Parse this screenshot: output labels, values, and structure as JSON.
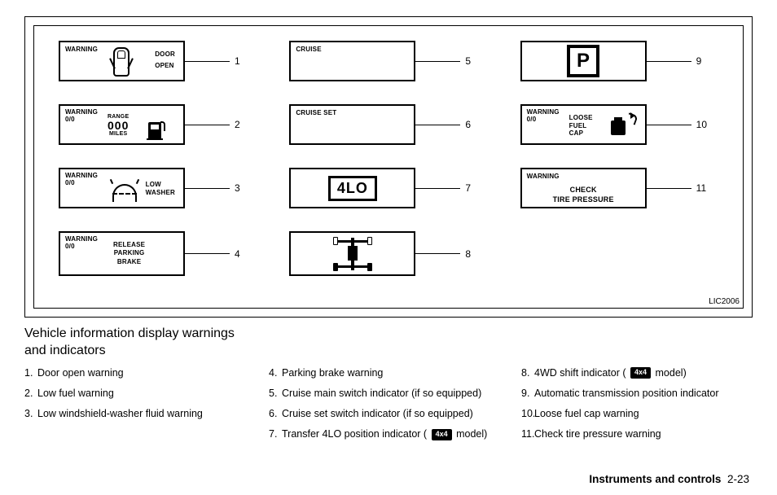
{
  "figure_code": "LIC2006",
  "panels": {
    "p1": {
      "label": "WARNING",
      "right1": "DOOR",
      "right2": "OPEN",
      "num": "1"
    },
    "p2": {
      "label1": "WARNING",
      "label2": "0/0",
      "range_label": "RANGE",
      "range_value": "000",
      "range_unit": "MILES",
      "num": "2"
    },
    "p3": {
      "label1": "WARNING",
      "label2": "0/0",
      "t1": "LOW",
      "t2": "WASHER",
      "num": "3"
    },
    "p4": {
      "label1": "WARNING",
      "label2": "0/0",
      "t1": "RELEASE",
      "t2": "PARKING",
      "t3": "BRAKE",
      "num": "4"
    },
    "p5": {
      "label": "CRUISE",
      "num": "5"
    },
    "p6": {
      "label": "CRUISE SET",
      "num": "6"
    },
    "p7": {
      "text": "4LO",
      "num": "7"
    },
    "p8": {
      "num": "8"
    },
    "p9": {
      "num": "9"
    },
    "p10": {
      "label1": "WARNING",
      "label2": "0/0",
      "t1": "LOOSE",
      "t2": "FUEL",
      "t3": "CAP",
      "num": "10"
    },
    "p11": {
      "label": "WARNING",
      "t1": "CHECK",
      "t2": "TIRE PRESSURE",
      "num": "11"
    }
  },
  "legend": {
    "title": "Vehicle information display warnings and indicators",
    "items": [
      "Door open warning",
      "Low fuel warning",
      "Low windshield-washer fluid warning",
      "Parking brake warning",
      "Cruise main switch indicator (if so equipped)",
      "Cruise set switch indicator (if so equipped)",
      "Transfer 4LO position indicator (",
      "4WD shift indicator (",
      "Automatic transmission position indicator",
      "Loose fuel cap warning",
      "Check tire pressure warning"
    ],
    "badge": "4x4",
    "model_suffix": " model)"
  },
  "footer": {
    "section": "Instruments and controls",
    "page": "2-23"
  }
}
